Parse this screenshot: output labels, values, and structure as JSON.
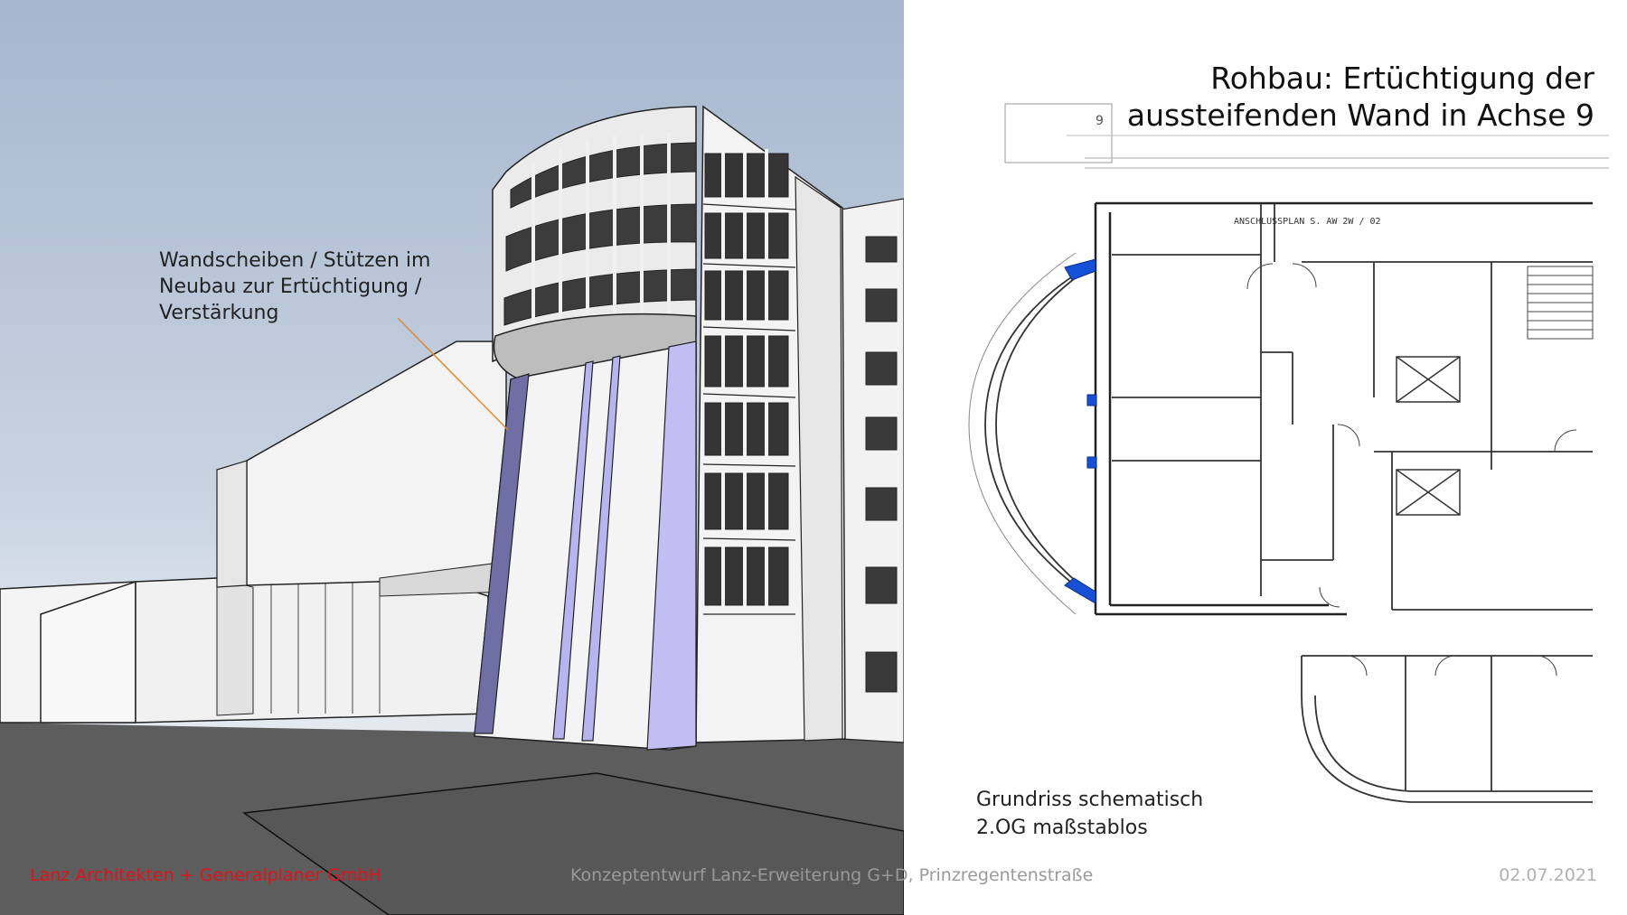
{
  "slide": {
    "title_line1": "Rohbau: Ertüchtigung der",
    "title_line2": "aussteifenden Wand in Achse 9",
    "annotation_line1": "Wandscheiben / Stützen im",
    "annotation_line2": "Neubau zur Ertüchtigung /",
    "annotation_line3": "Verstärkung",
    "plan_caption_line1": "Grundriss schematisch",
    "plan_caption_line2": "2.OG maßstablos",
    "plan_axis_label": "9",
    "plan_note": "ANSCHLUSSPLAN  S. AW 2W / 02"
  },
  "footer": {
    "company": "Lanz Architekten + Generalplaner GmbH",
    "project": "Konzeptentwurf Lanz-Erweiterung G+D, Prinzregentenstraße",
    "date": "02.07.2021"
  },
  "colors": {
    "company_text": "#e0141a",
    "sky_top": "#a5b7cf",
    "ground": "#5a5a5a",
    "reinforcement_blue": "#1550d6",
    "wall_highlight": "#b8b4f0"
  }
}
